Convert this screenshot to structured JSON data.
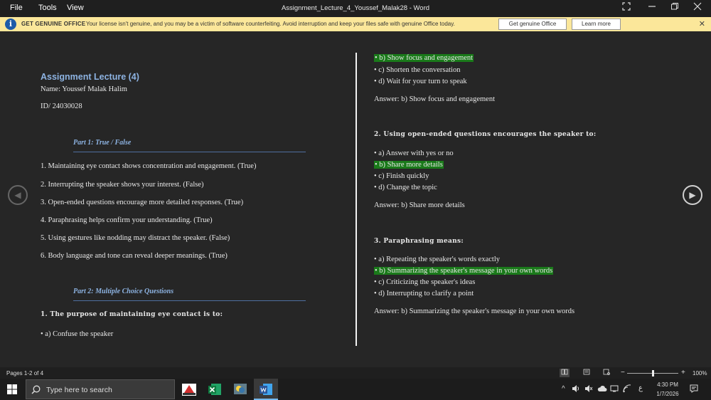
{
  "titlebar": {
    "menu": [
      "File",
      "Tools",
      "View"
    ],
    "title": "Assignment_Lecture_4_Youssef_Malak28  -  Word"
  },
  "banner": {
    "title": "GET GENUINE OFFICE",
    "message": "Your license isn't genuine, and you may be a victim of software counterfeiting. Avoid interruption and keep your files safe with genuine Office today.",
    "primary_button": "Get genuine Office",
    "secondary_button": "Learn more"
  },
  "left_page": {
    "title": "Assignment Lecture (4)",
    "name": "Name: Youssef Malak Halim",
    "id": "ID/ 24030028",
    "part1": "Part 1: True / False",
    "statements": [
      "1. Maintaining eye contact shows concentration and engagement.  (True)",
      "2. Interrupting the speaker shows your interest.  (False)",
      "3. Open-ended questions encourage more detailed responses.  (True)",
      "4. Paraphrasing helps confirm your understanding.  (True)",
      "5. Using gestures like nodding may distract the speaker.  (False)",
      "6. Body language and tone can reveal deeper meanings.  (True)"
    ],
    "part2": "Part 2: Multiple Choice Questions",
    "q1_heading": "1. The purpose of maintaining eye contact is to:",
    "q1_option_a": "• a) Confuse the speaker"
  },
  "right_page": {
    "q1_options": [
      "• b) Show focus and engagement",
      "• c) Shorten the conversation",
      "• d) Wait for your turn to speak"
    ],
    "q1_answer": "Answer: b) Show focus and engagement",
    "q2_heading": "2. Using open-ended questions encourages the speaker to:",
    "q2_options": [
      "• a) Answer with yes or no",
      "• b) Share more details",
      "• c) Finish quickly",
      "• d) Change the topic"
    ],
    "q2_answer": "Answer: b) Share more details",
    "q3_heading": "3. Paraphrasing means:",
    "q3_options": [
      "• a) Repeating the speaker's words exactly",
      "• b) Summarizing the speaker's message in your own words",
      "• c) Criticizing the speaker's ideas",
      "• d) Interrupting to clarify a point"
    ],
    "q3_answer": "Answer: b) Summarizing the speaker's message in your own words"
  },
  "statusbar": {
    "pages": "Pages 1-2 of 4",
    "zoom": "100%",
    "zoom_level": 0.5
  },
  "taskbar": {
    "search_placeholder": "Type here to search",
    "time": "4:30 PM",
    "date": "1/7/2026",
    "lang": "ع"
  },
  "colors": {
    "highlight": "#1a7a1a",
    "heading": "#8db3e2",
    "banner_bg": "#fbe79a",
    "word_blue": "#2b579a"
  },
  "icons": {
    "search": "search-icon",
    "windows": "windows-start-icon",
    "info": "info-icon"
  }
}
